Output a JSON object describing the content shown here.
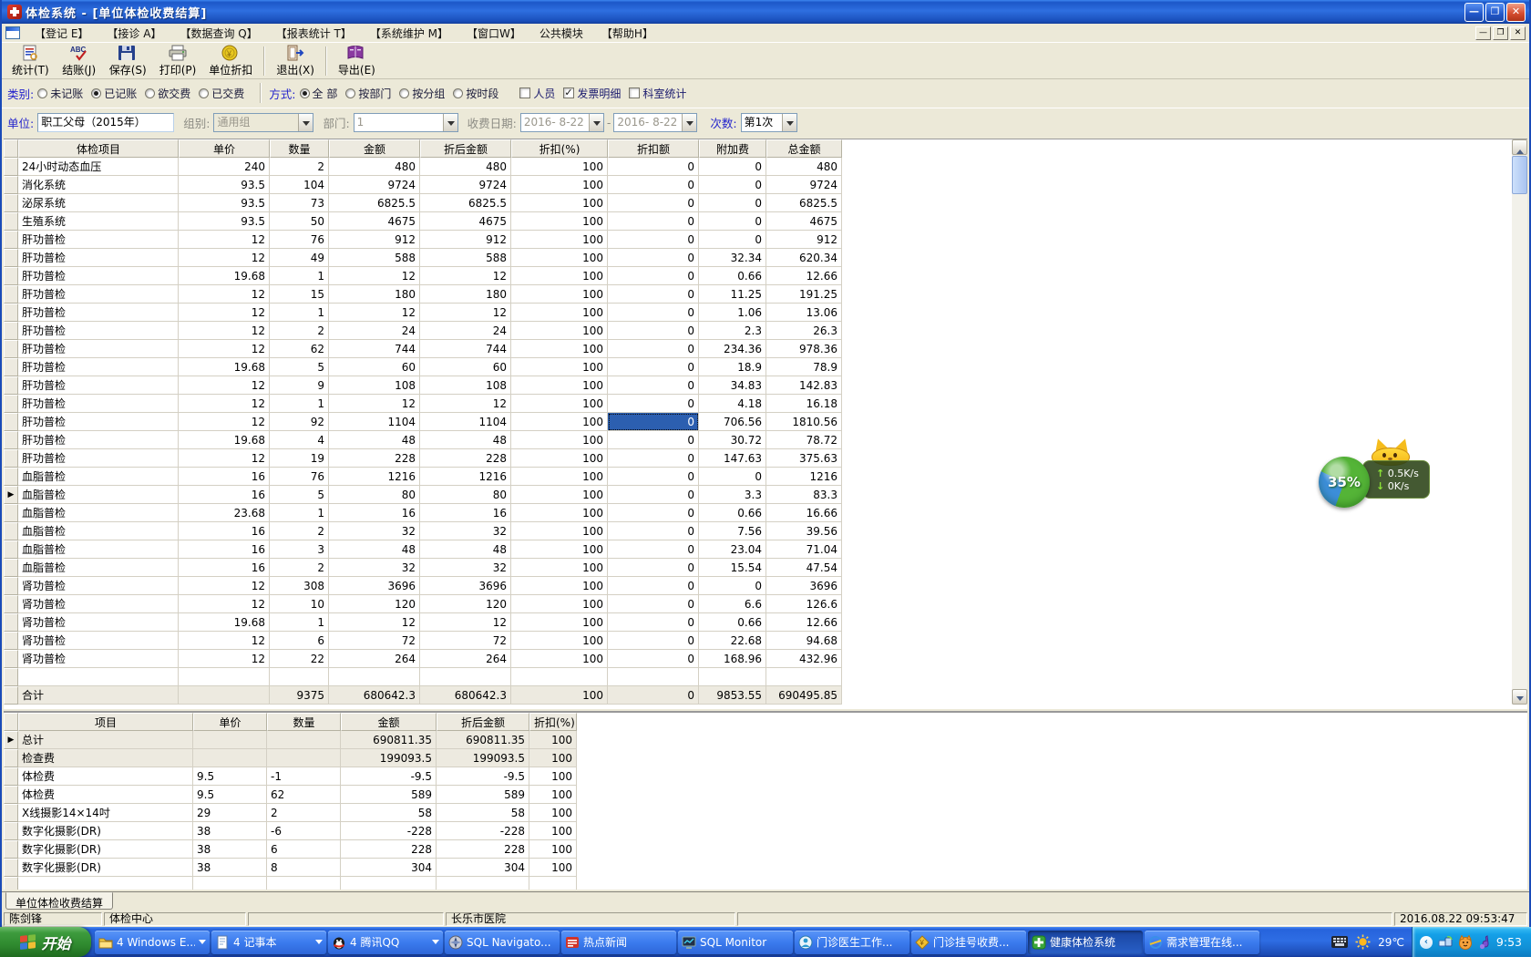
{
  "window": {
    "title": "体检系统  -  [单位体检收费结算]"
  },
  "menu": {
    "items": [
      "【登记 E】",
      "【接诊 A】",
      "【数据查询 Q】",
      "【报表统计 T】",
      "【系统维护 M】",
      "【窗口W】",
      "公共模块",
      "【帮助H】"
    ]
  },
  "toolbar": {
    "buttons": [
      {
        "label": "统计(T)",
        "icon": "statistics-icon",
        "sep_before": false
      },
      {
        "label": "结账(J)",
        "icon": "checkout-icon",
        "sep_before": false
      },
      {
        "label": "保存(S)",
        "icon": "save-icon",
        "sep_before": false
      },
      {
        "label": "打印(P)",
        "icon": "print-icon",
        "sep_before": false
      },
      {
        "label": "单位折扣",
        "icon": "coin-icon",
        "sep_before": false
      },
      {
        "label": "退出(X)",
        "icon": "exit-icon",
        "sep_before": true
      },
      {
        "label": "导出(E)",
        "icon": "export-icon",
        "sep_before": true
      }
    ]
  },
  "filters": {
    "category_label": "类别:",
    "category_options": [
      {
        "label": "未记账",
        "selected": false
      },
      {
        "label": "已记账",
        "selected": true
      },
      {
        "label": "欲交费",
        "selected": false
      },
      {
        "label": "已交费",
        "selected": false
      }
    ],
    "mode_label": "方式:",
    "mode_options": [
      {
        "label": "全  部",
        "selected": true
      },
      {
        "label": "按部门",
        "selected": false
      },
      {
        "label": "按分组",
        "selected": false
      },
      {
        "label": "按时段",
        "selected": false
      }
    ],
    "checkboxes": [
      {
        "label": "人员",
        "checked": false
      },
      {
        "label": "发票明细",
        "checked": true
      },
      {
        "label": "科室统计",
        "checked": false
      }
    ],
    "unit_label": "单位:",
    "unit_value": "职工父母（2015年）",
    "group_label": "组别:",
    "group_value": "通用组",
    "dept_label": "部门:",
    "dept_value": "1",
    "date_label": "收费日期:",
    "date_from": "2016- 8-22",
    "date_sep": "-",
    "date_to": "2016- 8-22",
    "times_label": "次数:",
    "times_value": "第1次"
  },
  "main_table": {
    "columns": [
      "体检项目",
      "单价",
      "数量",
      "金额",
      "折后金额",
      "折扣(%)",
      "折扣额",
      "附加费",
      "总金额"
    ],
    "rows": [
      [
        "24小时动态血压",
        "240",
        "2",
        "480",
        "480",
        "100",
        "0",
        "0",
        "480"
      ],
      [
        "消化系统",
        "93.5",
        "104",
        "9724",
        "9724",
        "100",
        "0",
        "0",
        "9724"
      ],
      [
        "泌尿系统",
        "93.5",
        "73",
        "6825.5",
        "6825.5",
        "100",
        "0",
        "0",
        "6825.5"
      ],
      [
        "生殖系统",
        "93.5",
        "50",
        "4675",
        "4675",
        "100",
        "0",
        "0",
        "4675"
      ],
      [
        "肝功普检",
        "12",
        "76",
        "912",
        "912",
        "100",
        "0",
        "0",
        "912"
      ],
      [
        "肝功普检",
        "12",
        "49",
        "588",
        "588",
        "100",
        "0",
        "32.34",
        "620.34"
      ],
      [
        "肝功普检",
        "19.68",
        "1",
        "12",
        "12",
        "100",
        "0",
        "0.66",
        "12.66"
      ],
      [
        "肝功普检",
        "12",
        "15",
        "180",
        "180",
        "100",
        "0",
        "11.25",
        "191.25"
      ],
      [
        "肝功普检",
        "12",
        "1",
        "12",
        "12",
        "100",
        "0",
        "1.06",
        "13.06"
      ],
      [
        "肝功普检",
        "12",
        "2",
        "24",
        "24",
        "100",
        "0",
        "2.3",
        "26.3"
      ],
      [
        "肝功普检",
        "12",
        "62",
        "744",
        "744",
        "100",
        "0",
        "234.36",
        "978.36"
      ],
      [
        "肝功普检",
        "19.68",
        "5",
        "60",
        "60",
        "100",
        "0",
        "18.9",
        "78.9"
      ],
      [
        "肝功普检",
        "12",
        "9",
        "108",
        "108",
        "100",
        "0",
        "34.83",
        "142.83"
      ],
      [
        "肝功普检",
        "12",
        "1",
        "12",
        "12",
        "100",
        "0",
        "4.18",
        "16.18"
      ],
      [
        "肝功普检",
        "12",
        "92",
        "1104",
        "1104",
        "100",
        "0",
        "706.56",
        "1810.56"
      ],
      [
        "肝功普检",
        "19.68",
        "4",
        "48",
        "48",
        "100",
        "0",
        "30.72",
        "78.72"
      ],
      [
        "肝功普检",
        "12",
        "19",
        "228",
        "228",
        "100",
        "0",
        "147.63",
        "375.63"
      ],
      [
        "血脂普检",
        "16",
        "76",
        "1216",
        "1216",
        "100",
        "0",
        "0",
        "1216"
      ],
      [
        "血脂普检",
        "16",
        "5",
        "80",
        "80",
        "100",
        "0",
        "3.3",
        "83.3"
      ],
      [
        "血脂普检",
        "23.68",
        "1",
        "16",
        "16",
        "100",
        "0",
        "0.66",
        "16.66"
      ],
      [
        "血脂普检",
        "16",
        "2",
        "32",
        "32",
        "100",
        "0",
        "7.56",
        "39.56"
      ],
      [
        "血脂普检",
        "16",
        "3",
        "48",
        "48",
        "100",
        "0",
        "23.04",
        "71.04"
      ],
      [
        "血脂普检",
        "16",
        "2",
        "32",
        "32",
        "100",
        "0",
        "15.54",
        "47.54"
      ],
      [
        "肾功普检",
        "12",
        "308",
        "3696",
        "3696",
        "100",
        "0",
        "0",
        "3696"
      ],
      [
        "肾功普检",
        "12",
        "10",
        "120",
        "120",
        "100",
        "0",
        "6.6",
        "126.6"
      ],
      [
        "肾功普检",
        "19.68",
        "1",
        "12",
        "12",
        "100",
        "0",
        "0.66",
        "12.66"
      ],
      [
        "肾功普检",
        "12",
        "6",
        "72",
        "72",
        "100",
        "0",
        "22.68",
        "94.68"
      ],
      [
        "肾功普检",
        "12",
        "22",
        "264",
        "264",
        "100",
        "0",
        "168.96",
        "432.96"
      ]
    ],
    "total_row": [
      "合计",
      "",
      "9375",
      "680642.3",
      "680642.3",
      "100",
      "0",
      "9853.55",
      "690495.85"
    ],
    "selected_cell": {
      "row": 14,
      "col": 6
    },
    "arrow_row": 18
  },
  "summary_table": {
    "columns": [
      "项目",
      "单价",
      "数量",
      "金额",
      "折后金额",
      "折扣(%)"
    ],
    "rows": [
      [
        "总计",
        "",
        "",
        "690811.35",
        "690811.35",
        "100"
      ],
      [
        "检查费",
        "",
        "",
        "199093.5",
        "199093.5",
        "100"
      ],
      [
        "体检费",
        "9.5",
        "-1",
        "-9.5",
        "-9.5",
        "100"
      ],
      [
        "体检费",
        "9.5",
        "62",
        "589",
        "589",
        "100"
      ],
      [
        "X线摄影14×14吋",
        "29",
        "2",
        "58",
        "58",
        "100"
      ],
      [
        "数字化摄影(DR)",
        "38",
        "-6",
        "-228",
        "-228",
        "100"
      ],
      [
        "数字化摄影(DR)",
        "38",
        "6",
        "228",
        "228",
        "100"
      ],
      [
        "数字化摄影(DR)",
        "38",
        "8",
        "304",
        "304",
        "100"
      ]
    ],
    "shaded_rows": [
      0,
      1
    ],
    "arrow_row": 0
  },
  "tabbar": {
    "tab": "单位体检收费结算"
  },
  "statusbar": {
    "user": "陈剑锋",
    "dept": "体检中心",
    "hospital": "长乐市医院",
    "datetime": "2016.08.22 09:53:47"
  },
  "taskbar": {
    "start_label": "开始",
    "items": [
      {
        "label": "4 Windows E...",
        "icon": "folder-icon",
        "dropdown": true,
        "active": false
      },
      {
        "label": "4 记事本",
        "icon": "notepad-icon",
        "dropdown": true,
        "active": false
      },
      {
        "label": "4 腾讯QQ",
        "icon": "qq-icon",
        "dropdown": true,
        "active": false
      },
      {
        "label": "SQL Navigato...",
        "icon": "sql-navigator-icon",
        "dropdown": false,
        "active": false
      },
      {
        "label": "热点新闻",
        "icon": "news-icon",
        "dropdown": false,
        "active": false
      },
      {
        "label": "SQL Monitor",
        "icon": "sql-monitor-icon",
        "dropdown": false,
        "active": false
      },
      {
        "label": "门诊医生工作...",
        "icon": "clinic-doctor-icon",
        "dropdown": false,
        "active": false
      },
      {
        "label": "门诊挂号收费...",
        "icon": "registration-icon",
        "dropdown": false,
        "active": false
      },
      {
        "label": "健康体检系统",
        "icon": "health-exam-icon",
        "dropdown": false,
        "active": true
      },
      {
        "label": "需求管理在线...",
        "icon": "ie-icon",
        "dropdown": false,
        "active": false
      }
    ],
    "tray": {
      "temperature": "29℃",
      "clock": "9:53"
    }
  },
  "speed_widget": {
    "percent": "35%",
    "up": "0.5K/s",
    "down": "0K/s"
  },
  "colors": {
    "selection": "#2C5FB0",
    "beige": "#ECE9D8",
    "taskbar_blue": "#2E6DE4",
    "start_green": "#2F8A2F",
    "tray_blue": "#14A0E8"
  }
}
